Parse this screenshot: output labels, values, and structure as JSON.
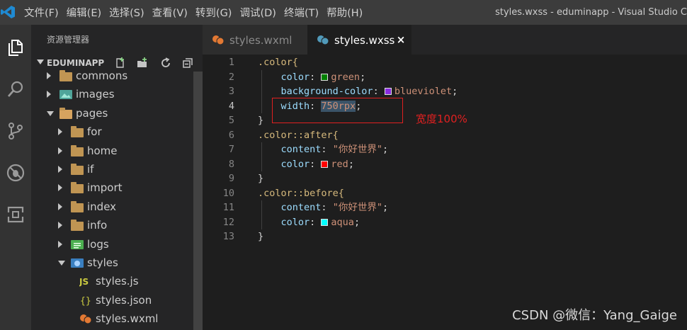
{
  "window": {
    "title": "styles.wxss - eduminapp - Visual Studio C",
    "menu": [
      "文件(F)",
      "编辑(E)",
      "选择(S)",
      "查看(V)",
      "转到(G)",
      "调试(D)",
      "终端(T)",
      "帮助(H)"
    ]
  },
  "activitybar": {
    "icons": [
      "explorer-icon",
      "search-icon",
      "source-control-icon",
      "debug-icon",
      "extensions-icon"
    ]
  },
  "sidebar": {
    "title": "资源管理器",
    "project": "EDUMINAPP",
    "tree": [
      {
        "label": "commons",
        "type": "folder",
        "state": "collapsed",
        "depth": 1
      },
      {
        "label": "images",
        "type": "images-folder",
        "state": "collapsed",
        "depth": 1
      },
      {
        "label": "pages",
        "type": "folder-open",
        "state": "expanded",
        "depth": 1
      },
      {
        "label": "for",
        "type": "folder",
        "state": "collapsed",
        "depth": 2
      },
      {
        "label": "home",
        "type": "folder",
        "state": "collapsed",
        "depth": 2
      },
      {
        "label": "if",
        "type": "folder",
        "state": "collapsed",
        "depth": 2
      },
      {
        "label": "import",
        "type": "folder",
        "state": "collapsed",
        "depth": 2
      },
      {
        "label": "index",
        "type": "folder",
        "state": "collapsed",
        "depth": 2
      },
      {
        "label": "info",
        "type": "folder",
        "state": "collapsed",
        "depth": 2
      },
      {
        "label": "logs",
        "type": "logs-folder",
        "state": "collapsed",
        "depth": 2
      },
      {
        "label": "styles",
        "type": "styles-folder",
        "state": "expanded",
        "depth": 2
      },
      {
        "label": "styles.js",
        "type": "js-file",
        "state": "file",
        "depth": 3
      },
      {
        "label": "styles.json",
        "type": "json-file",
        "state": "file",
        "depth": 3
      },
      {
        "label": "styles.wxml",
        "type": "wxml-file",
        "state": "file",
        "depth": 3
      }
    ]
  },
  "tabs": [
    {
      "label": "styles.wxml",
      "active": false
    },
    {
      "label": "styles.wxss",
      "active": true,
      "close": "×"
    }
  ],
  "editor": {
    "active_line": 4,
    "lines": [
      {
        "n": "1",
        "sel": ".color{"
      },
      {
        "n": "2",
        "prop": "color",
        "swatch": "#008000",
        "value": "green"
      },
      {
        "n": "3",
        "prop": "background-color",
        "swatch": "#8a2be2",
        "value": "blueviolet"
      },
      {
        "n": "4",
        "prop": "width",
        "value": "750rpx"
      },
      {
        "n": "5",
        "sel": "}"
      },
      {
        "n": "6",
        "sel": ".color::after{"
      },
      {
        "n": "7",
        "prop": "content",
        "value": "\"你好世界\""
      },
      {
        "n": "8",
        "prop": "color",
        "swatch": "#ff0000",
        "value": "red"
      },
      {
        "n": "9",
        "sel": "}"
      },
      {
        "n": "10",
        "sel": ".color::before{"
      },
      {
        "n": "11",
        "prop": "content",
        "value": "\"你好世界\""
      },
      {
        "n": "12",
        "prop": "color",
        "swatch": "#00ffff",
        "value": "aqua"
      },
      {
        "n": "13",
        "sel": "}"
      }
    ],
    "annotation": "宽度100%"
  },
  "watermark": "CSDN @微信：Yang_Gaige",
  "colors": {
    "titlebar": "#3c3c3c",
    "activitybar": "#333333",
    "sidebar": "#252526",
    "editor": "#1e1e1e",
    "annotation": "#e02020"
  }
}
